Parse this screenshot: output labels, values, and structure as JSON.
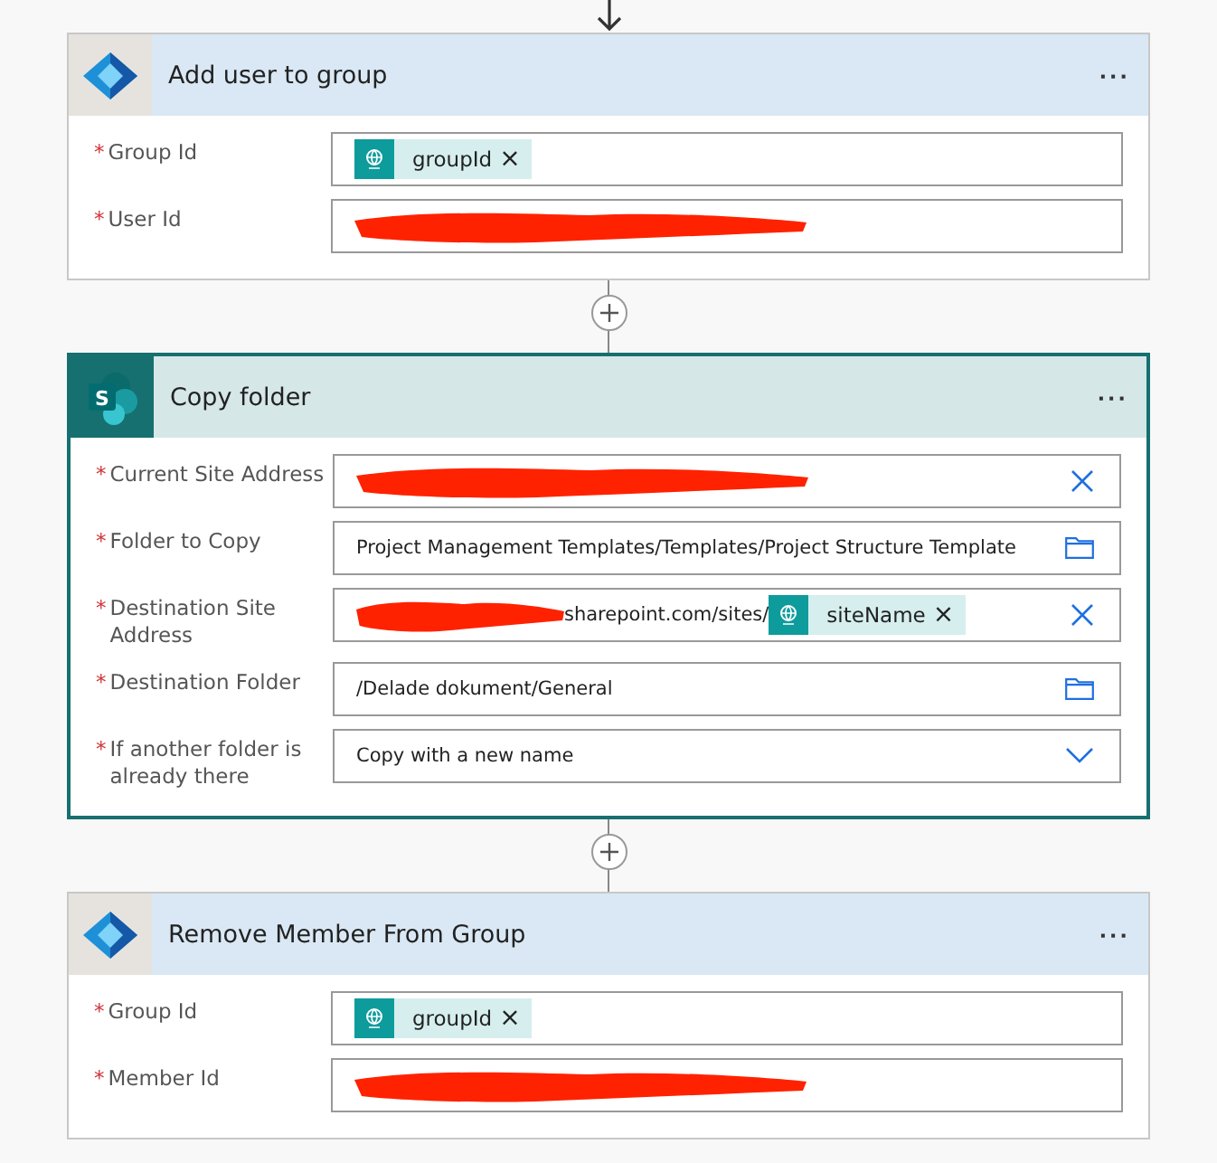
{
  "cards": [
    {
      "title": "Add user to group",
      "kind": "directory",
      "selected": false,
      "menu": "···",
      "fields": [
        {
          "label": "Group Id",
          "mark": "*",
          "kind": "plain",
          "parts": [
            {
              "kind": "token",
              "text": "groupId",
              "remove": "×"
            }
          ]
        },
        {
          "label": "User Id",
          "mark": "*",
          "kind": "plain",
          "parts": [
            {
              "kind": "redaction",
              "short": false
            }
          ]
        }
      ]
    },
    {
      "title": "Copy folder",
      "kind": "sharepoint",
      "icon_letter": "S",
      "selected": true,
      "menu": "···",
      "fields": [
        {
          "label": "Current Site Address",
          "mark": "*",
          "kind": "clear",
          "parts": [
            {
              "kind": "redaction",
              "short": false
            }
          ]
        },
        {
          "label": "Folder to Copy",
          "mark": "*",
          "kind": "folder",
          "parts": [
            {
              "kind": "text",
              "text": "Project Management Templates/Templates/Project Structure Template"
            }
          ]
        },
        {
          "label": "Destination Site Address",
          "mark": "*",
          "kind": "clear",
          "parts": [
            {
              "kind": "redaction",
              "short": true
            },
            {
              "kind": "text",
              "text": "sharepoint.com/sites/"
            },
            {
              "kind": "token",
              "text": "siteName",
              "remove": "×"
            }
          ]
        },
        {
          "label": "Destination Folder",
          "mark": "*",
          "kind": "folder",
          "parts": [
            {
              "kind": "text",
              "text": "/Delade dokument/General"
            }
          ]
        },
        {
          "label": "If another folder is already there",
          "mark": "*",
          "kind": "dropdown",
          "parts": [
            {
              "kind": "text",
              "text": "Copy with a new name"
            }
          ]
        }
      ]
    },
    {
      "title": "Remove Member From Group",
      "kind": "directory",
      "selected": false,
      "menu": "···",
      "fields": [
        {
          "label": "Group Id",
          "mark": "*",
          "kind": "plain",
          "parts": [
            {
              "kind": "token",
              "text": "groupId",
              "remove": "×"
            }
          ]
        },
        {
          "label": "Member Id",
          "mark": "*",
          "kind": "plain",
          "parts": [
            {
              "kind": "redaction",
              "short": false
            }
          ]
        }
      ]
    }
  ]
}
